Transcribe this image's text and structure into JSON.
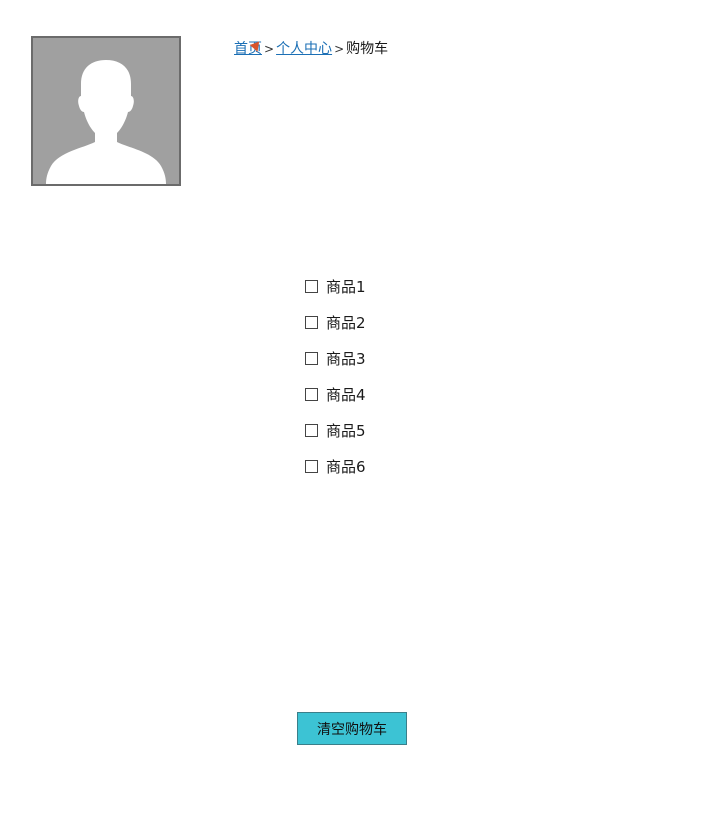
{
  "avatar": {
    "icon": "user-silhouette-icon"
  },
  "breadcrumb": {
    "home": "首页",
    "separator": ">",
    "personal_center": "个人中心",
    "current": "购物车"
  },
  "cart": {
    "items": [
      {
        "label": "商品1",
        "checked": false
      },
      {
        "label": "商品2",
        "checked": false
      },
      {
        "label": "商品3",
        "checked": false
      },
      {
        "label": "商品4",
        "checked": false
      },
      {
        "label": "商品5",
        "checked": false
      },
      {
        "label": "商品6",
        "checked": false
      }
    ],
    "clear_button_label": "清空购物车"
  },
  "colors": {
    "link": "#1b6fb5",
    "button_bg": "#3cc3d4",
    "avatar_bg": "#a0a0a0"
  }
}
